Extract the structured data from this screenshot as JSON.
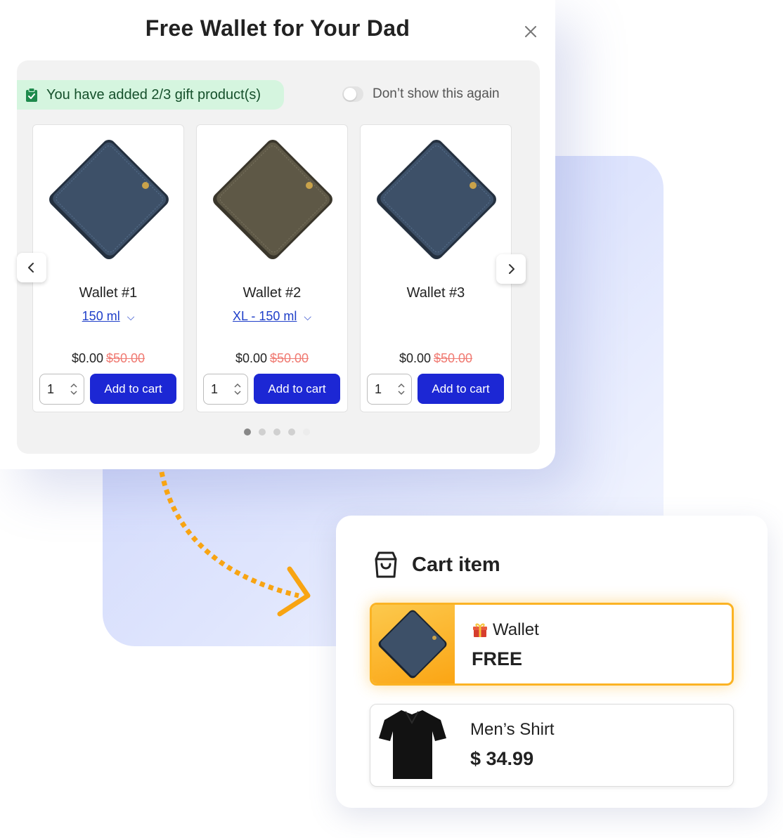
{
  "popup": {
    "title": "Free Wallet for Your Dad",
    "banner_text": "You have added 2/3 gift product(s)",
    "toggle_label": "Don’t show this again",
    "products": [
      {
        "name": "Wallet #1",
        "variant": "150 ml",
        "price": "$0.00",
        "old_price": "$50.00",
        "qty": "1",
        "button": "Add to cart",
        "color": "#3d5068"
      },
      {
        "name": "Wallet #2",
        "variant": "XL - 150 ml",
        "price": "$0.00",
        "old_price": "$50.00",
        "qty": "1",
        "button": "Add to cart",
        "color": "#5e5846"
      },
      {
        "name": "Wallet #3",
        "variant": "",
        "price": "$0.00",
        "old_price": "$50.00",
        "qty": "1",
        "button": "Add to cart",
        "color": "#3d5068"
      }
    ],
    "pagination": {
      "count": 5,
      "active": 1
    }
  },
  "cart": {
    "title": "Cart item",
    "items": [
      {
        "name": "Wallet",
        "price": "FREE",
        "gift": true
      },
      {
        "name": "Men’s Shirt",
        "price": "$ 34.99",
        "gift": false
      }
    ]
  },
  "colors": {
    "accent_button": "#1c27d4",
    "banner_bg": "#d5f5df",
    "gift_highlight": "#fbb324",
    "old_price": "#f07a72",
    "link": "#1f3fc9"
  },
  "icons": [
    "close-icon",
    "clipboard-check-icon",
    "chevron-left-icon",
    "chevron-right-icon",
    "chevron-down-icon",
    "shopping-bag-icon",
    "gift-icon"
  ]
}
